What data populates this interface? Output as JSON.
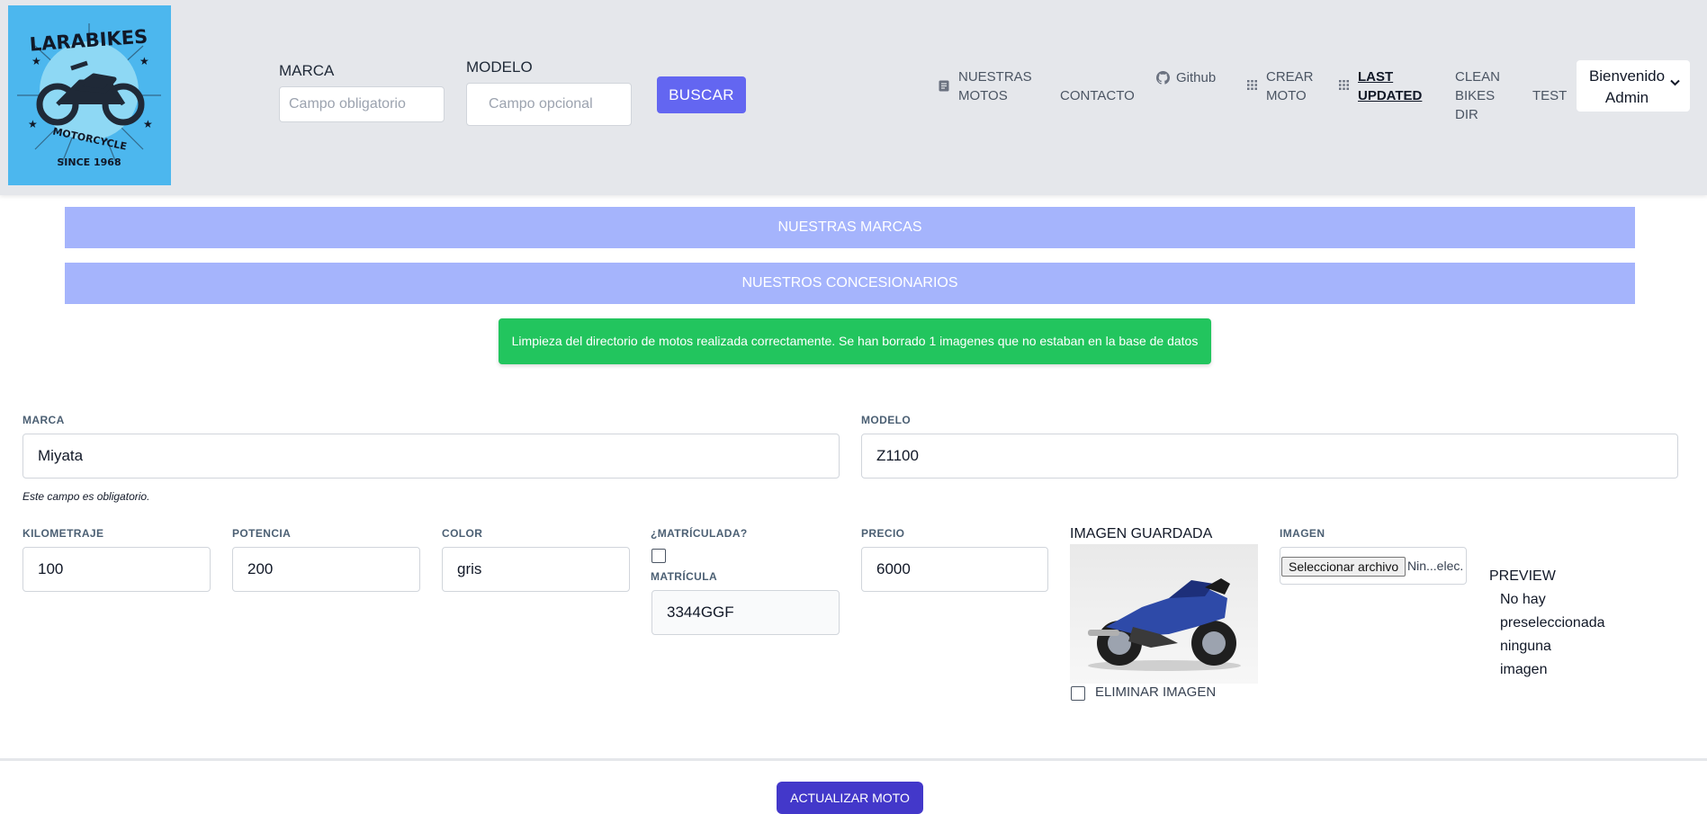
{
  "search": {
    "marca_label": "MARCA",
    "marca_placeholder": "Campo obligatorio",
    "modelo_label": "MODELO",
    "modelo_placeholder": "Campo opcional",
    "buscar_label": "BUSCAR"
  },
  "logo": {
    "top_text": "LARABIKES",
    "mid_text": "MOTORCYCLE",
    "bottom_text": "SINCE 1968"
  },
  "nav": {
    "nuestras_motos": [
      "NUESTRAS",
      "MOTOS"
    ],
    "contacto": "CONTACTO",
    "github": "Github",
    "crear_moto": [
      "CREAR",
      "MOTO"
    ],
    "last_updated": [
      "LAST",
      "UPDATED"
    ],
    "clean_bikes_dir": [
      "CLEAN",
      "BIKES",
      "DIR"
    ],
    "test": "TEST",
    "user_menu": [
      "Bienvenido",
      "Admin"
    ]
  },
  "banners": {
    "marcas": "NUESTRAS MARCAS",
    "concesionarios": "NUESTROS CONCESIONARIOS"
  },
  "alert": "Limpieza del directorio de motos realizada correctamente. Se han borrado 1 imagenes que no estaban en la base de datos",
  "form": {
    "marca_label": "MARCA",
    "marca_value": "Miyata",
    "marca_hint": "Este campo es obligatorio.",
    "modelo_label": "MODELO",
    "modelo_value": "Z1100",
    "kilometraje_label": "KILOMETRAJE",
    "kilometraje_value": "100",
    "potencia_label": "POTENCIA",
    "potencia_value": "200",
    "color_label": "COLOR",
    "color_value": "gris",
    "matriculada_label": "¿MATRÍCULADA?",
    "matriculada_checked": false,
    "matricula_label": "MATRÍCULA",
    "matricula_value": "3344GGF",
    "precio_label": "PRECIO",
    "precio_value": "6000",
    "imagen_guardada_label": "IMAGEN GUARDADA",
    "eliminar_imagen_label": "ELIMINAR IMAGEN",
    "imagen_label": "IMAGEN",
    "file_button_label": "Seleccionar archivo",
    "file_name": "Nin...elec.",
    "preview_title": "PREVIEW",
    "preview_text": [
      "No hay",
      "preseleccionada",
      "ninguna",
      "imagen"
    ],
    "submit_label": "ACTUALIZAR MOTO"
  },
  "colors": {
    "header_bg": "#e5e7eb",
    "primary": "#6366f1",
    "banner": "#a5b4fc",
    "success": "#22c55e",
    "submit": "#4338ca",
    "logo_bg": "#4cb7ee"
  }
}
